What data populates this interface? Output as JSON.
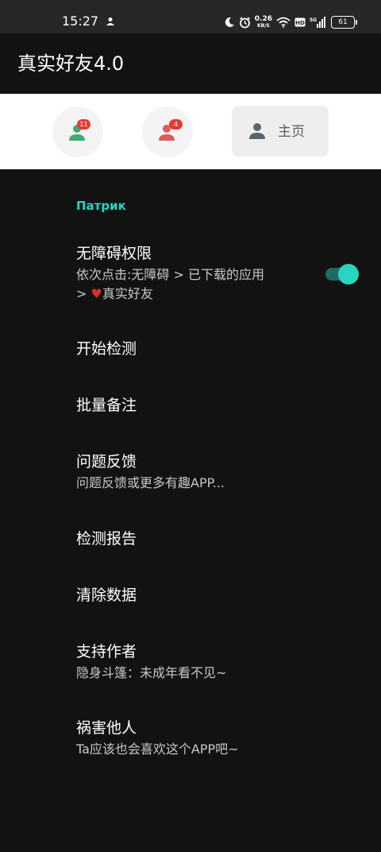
{
  "status_bar": {
    "time": "15:27",
    "net_speed": "0.26",
    "net_unit": "KB/S",
    "hd": "HD",
    "signal_label": "5G",
    "battery": "61"
  },
  "app_bar": {
    "title": "真实好友4.0"
  },
  "tabs": {
    "friends_badge": "11",
    "blocked_badge": "4",
    "home_label": "主页"
  },
  "section": {
    "header": "Патрик"
  },
  "preferences": [
    {
      "title": "无障碍权限",
      "summary_line1": "依次点击:无障碍 > 已下载的应用",
      "summary_line2_prefix": "> ",
      "summary_line2_suffix": "真实好友"
    },
    {
      "title": "开始检测"
    },
    {
      "title": "批量备注"
    },
    {
      "title": "问题反馈",
      "summary": "问题反馈或更多有趣APP..."
    },
    {
      "title": "检测报告"
    },
    {
      "title": "清除数据"
    },
    {
      "title": "支持作者",
      "summary": "隐身斗篷：未成年看不见~"
    },
    {
      "title": "祸害他人",
      "summary": "Ta应该也会喜欢这个APP吧~"
    }
  ],
  "accessibility_toggle": {
    "on": true
  },
  "colors": {
    "accent": "#2ad4c0",
    "background": "#121212",
    "badge": "#e53935",
    "heart": "#d93025"
  },
  "icons": {
    "friends_tab": "person-green-icon",
    "blocked_tab": "person-red-icon",
    "home_tab": "person-icon",
    "heart": "heart-icon"
  }
}
